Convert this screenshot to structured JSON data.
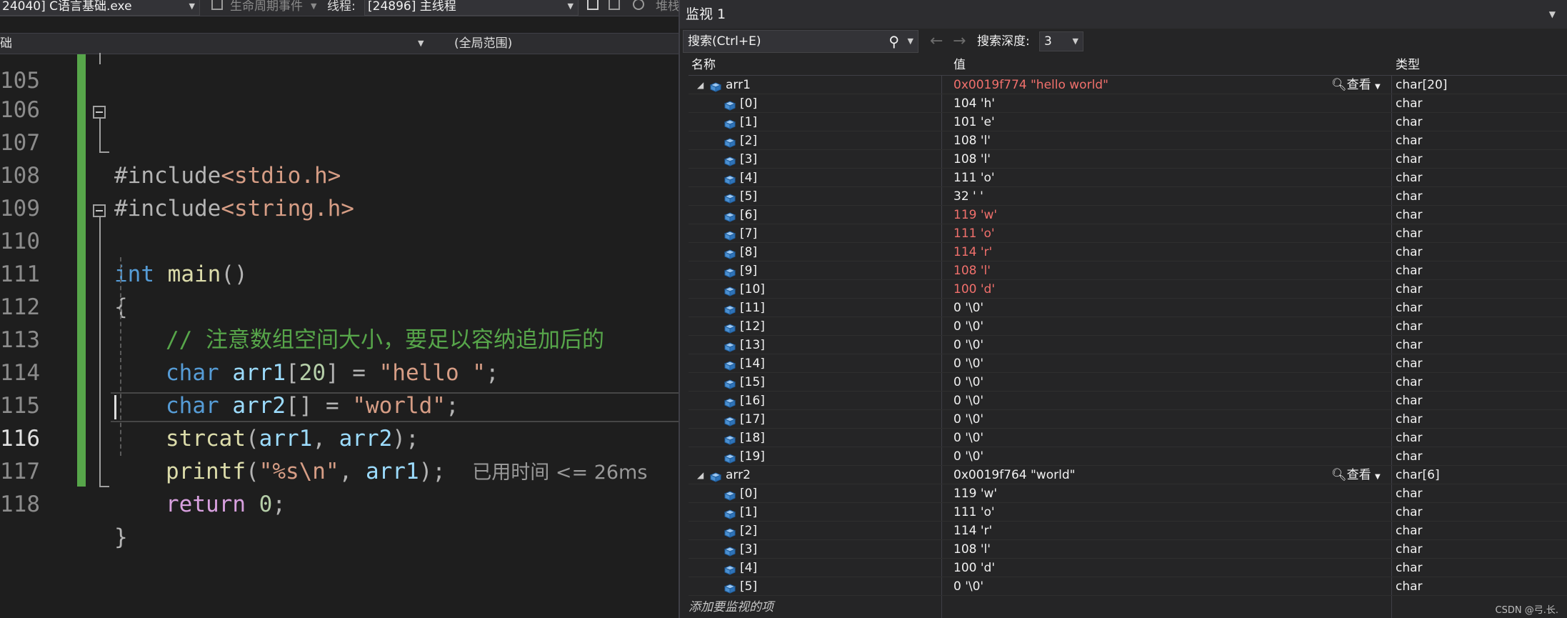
{
  "toolbar": {
    "process": "24040] C语言基础.exe",
    "lifecycle": "生命周期事件",
    "thread_label": "线程:",
    "thread": "[24896] 主线程",
    "stack": "堆栈帧:"
  },
  "scope": {
    "left": "础",
    "right": "(全局范围)"
  },
  "editor": {
    "partial_line": "105",
    "lines": [
      {
        "no": "106"
      },
      {
        "no": "107",
        "include": "#include",
        "file": "<stdio.h>"
      },
      {
        "no": "108",
        "include": "#include",
        "file": "<string.h>"
      },
      {
        "no": "109"
      },
      {
        "no": "110",
        "kw": "int",
        "fn": "main",
        "rest": "()"
      },
      {
        "no": "111",
        "text": "{"
      },
      {
        "no": "112",
        "comment": "// 注意数组空间大小，要足以容纳追加后的"
      },
      {
        "no": "113",
        "kw": "char",
        "var": "arr1",
        "pre": "[",
        "num": "20",
        "mid": "] = ",
        "str": "\"hello \"",
        "end": ";"
      },
      {
        "no": "114",
        "kw": "char",
        "var": "arr2",
        "mid": "[] = ",
        "str": "\"world\"",
        "end": ";"
      },
      {
        "no": "115",
        "fn": "strcat",
        "args_open": "(",
        "a1": "arr1",
        "comma": ", ",
        "a2": "arr2",
        "end": ");"
      },
      {
        "no": "116",
        "fn": "printf",
        "args_open": "(",
        "str": "\"%s\\n\"",
        "comma": ", ",
        "a1": "arr1",
        "end": ");",
        "hint": "已用时间 <= 26ms"
      },
      {
        "no": "117",
        "kw": "return",
        "num": "0",
        "end": ";"
      },
      {
        "no": "118",
        "text": "}"
      }
    ]
  },
  "watch": {
    "title": "监视 1",
    "search_placeholder": "搜索(Ctrl+E)",
    "depth_label": "搜索深度:",
    "depth_value": "3",
    "columns": {
      "name": "名称",
      "value": "值",
      "type": "类型"
    },
    "view_label": "查看",
    "arr1": {
      "name": "arr1",
      "value": "0x0019f774 \"hello world\"",
      "type": "char[20]"
    },
    "arr1_items": [
      {
        "name": "[0]",
        "value": "104 'h'",
        "type": "char",
        "changed": false
      },
      {
        "name": "[1]",
        "value": "101 'e'",
        "type": "char",
        "changed": false
      },
      {
        "name": "[2]",
        "value": "108 'l'",
        "type": "char",
        "changed": false
      },
      {
        "name": "[3]",
        "value": "108 'l'",
        "type": "char",
        "changed": false
      },
      {
        "name": "[4]",
        "value": "111 'o'",
        "type": "char",
        "changed": false
      },
      {
        "name": "[5]",
        "value": "32 ' '",
        "type": "char",
        "changed": false
      },
      {
        "name": "[6]",
        "value": "119 'w'",
        "type": "char",
        "changed": true
      },
      {
        "name": "[7]",
        "value": "111 'o'",
        "type": "char",
        "changed": true
      },
      {
        "name": "[8]",
        "value": "114 'r'",
        "type": "char",
        "changed": true
      },
      {
        "name": "[9]",
        "value": "108 'l'",
        "type": "char",
        "changed": true
      },
      {
        "name": "[10]",
        "value": "100 'd'",
        "type": "char",
        "changed": true
      },
      {
        "name": "[11]",
        "value": "0 '\\0'",
        "type": "char",
        "changed": false
      },
      {
        "name": "[12]",
        "value": "0 '\\0'",
        "type": "char",
        "changed": false
      },
      {
        "name": "[13]",
        "value": "0 '\\0'",
        "type": "char",
        "changed": false
      },
      {
        "name": "[14]",
        "value": "0 '\\0'",
        "type": "char",
        "changed": false
      },
      {
        "name": "[15]",
        "value": "0 '\\0'",
        "type": "char",
        "changed": false
      },
      {
        "name": "[16]",
        "value": "0 '\\0'",
        "type": "char",
        "changed": false
      },
      {
        "name": "[17]",
        "value": "0 '\\0'",
        "type": "char",
        "changed": false
      },
      {
        "name": "[18]",
        "value": "0 '\\0'",
        "type": "char",
        "changed": false
      },
      {
        "name": "[19]",
        "value": "0 '\\0'",
        "type": "char",
        "changed": false
      }
    ],
    "arr2": {
      "name": "arr2",
      "value": "0x0019f764 \"world\"",
      "type": "char[6]"
    },
    "arr2_items": [
      {
        "name": "[0]",
        "value": "119 'w'",
        "type": "char",
        "changed": false
      },
      {
        "name": "[1]",
        "value": "111 'o'",
        "type": "char",
        "changed": false
      },
      {
        "name": "[2]",
        "value": "114 'r'",
        "type": "char",
        "changed": false
      },
      {
        "name": "[3]",
        "value": "108 'l'",
        "type": "char",
        "changed": false
      },
      {
        "name": "[4]",
        "value": "100 'd'",
        "type": "char",
        "changed": false
      },
      {
        "name": "[5]",
        "value": "0 '\\0'",
        "type": "char",
        "changed": false
      }
    ],
    "add_item": "添加要监视的项",
    "credit": "CSDN @弓.长."
  }
}
